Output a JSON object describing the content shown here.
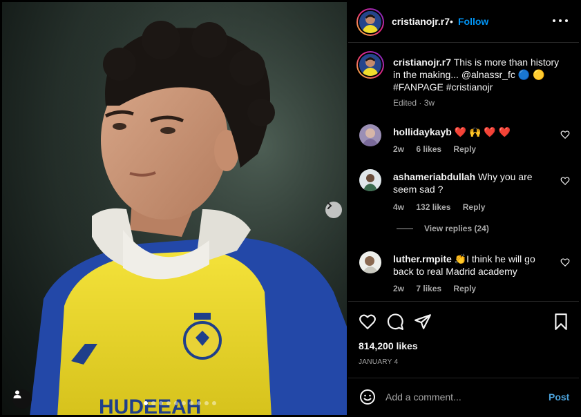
{
  "post": {
    "username": "cristianojr.r7",
    "separator": "•",
    "follow_label": "Follow",
    "caption_text": "This is more than history in the making... @alnassr_fc 🔵 🟡 #FANPAGE #cristianojr",
    "caption_meta": "Edited · 3w",
    "carousel": {
      "total_slides": 10,
      "active_index": 0
    },
    "jersey_brand_text": "HUDEEAH"
  },
  "comments": [
    {
      "username": "hollidaykayb",
      "text": "❤️ 🙌 ❤️ ❤️",
      "age": "2w",
      "likes": "6 likes",
      "reply_label": "Reply"
    },
    {
      "username": "ashameriabdullah",
      "text": "Why you are seem sad ?",
      "age": "4w",
      "likes": "132 likes",
      "reply_label": "Reply",
      "view_replies": "View replies (24)"
    },
    {
      "username": "luther.rmpite",
      "text": "👏I think he will go back to real Madrid academy",
      "age": "2w",
      "likes": "7 likes",
      "reply_label": "Reply"
    }
  ],
  "actions": {
    "icons": [
      "heart-icon",
      "comment-icon",
      "share-icon",
      "bookmark-icon"
    ],
    "likes_count": "814,200 likes",
    "date": "JANUARY 4"
  },
  "add_comment": {
    "placeholder": "Add a comment...",
    "post_label": "Post"
  },
  "colors": {
    "accent": "#0095f6",
    "post_button": "#4ca3dc",
    "background": "#000000",
    "muted_text": "#a8a8a8",
    "heart_emoji": "#e0245e"
  }
}
